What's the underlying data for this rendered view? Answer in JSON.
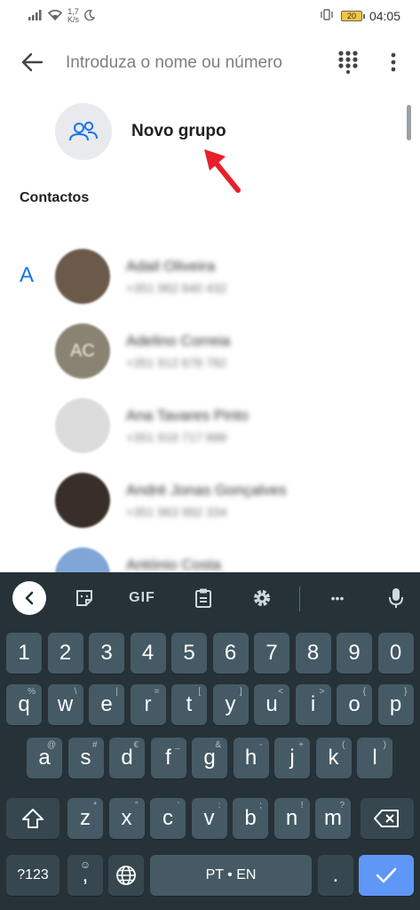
{
  "status_bar": {
    "speed_value": "1,7",
    "speed_unit": "K/s",
    "battery": "20",
    "time": "04:05"
  },
  "header": {
    "search_placeholder": "Introduza o nome ou número"
  },
  "new_group": {
    "label": "Novo grupo"
  },
  "section_title": "Contactos",
  "index_letter": "A",
  "contacts": [
    {
      "name": "Adail Oliveira",
      "phone": "+351 962 840 432",
      "avatar_color": "#6b5a4a"
    },
    {
      "name": "Adelino Correia",
      "phone": "+351 912 678 782",
      "avatar_color": "#8a8372",
      "initials": "AC"
    },
    {
      "name": "Ana Tavares Pinto",
      "phone": "+351 916 717 888",
      "avatar_color": "#dcdcdc"
    },
    {
      "name": "André Jonas Gonçalves",
      "phone": "+351 963 992 334",
      "avatar_color": "#3a2f28"
    },
    {
      "name": "António Costa",
      "phone": "",
      "avatar_color": "#7fa6d6"
    }
  ],
  "keyboard": {
    "toolbar": {
      "gif": "GIF",
      "more": "•••"
    },
    "row_numbers": [
      "1",
      "2",
      "3",
      "4",
      "5",
      "6",
      "7",
      "8",
      "9",
      "0"
    ],
    "row1": [
      {
        "k": "q",
        "h": "%"
      },
      {
        "k": "w",
        "h": "\\"
      },
      {
        "k": "e",
        "h": "|"
      },
      {
        "k": "r",
        "h": "="
      },
      {
        "k": "t",
        "h": "["
      },
      {
        "k": "y",
        "h": "]"
      },
      {
        "k": "u",
        "h": "<"
      },
      {
        "k": "i",
        "h": ">"
      },
      {
        "k": "o",
        "h": "{"
      },
      {
        "k": "p",
        "h": "}"
      }
    ],
    "row2": [
      {
        "k": "a",
        "h": "@"
      },
      {
        "k": "s",
        "h": "#"
      },
      {
        "k": "d",
        "h": "€"
      },
      {
        "k": "f",
        "h": "_"
      },
      {
        "k": "g",
        "h": "&"
      },
      {
        "k": "h",
        "h": "-"
      },
      {
        "k": "j",
        "h": "+"
      },
      {
        "k": "k",
        "h": "("
      },
      {
        "k": "l",
        "h": ")"
      }
    ],
    "row3": [
      {
        "k": "z",
        "h": "*"
      },
      {
        "k": "x",
        "h": "\""
      },
      {
        "k": "c",
        "h": "'"
      },
      {
        "k": "v",
        "h": ":"
      },
      {
        "k": "b",
        "h": ";"
      },
      {
        "k": "n",
        "h": "!"
      },
      {
        "k": "m",
        "h": "?"
      }
    ],
    "symbols_key": "?123",
    "comma": ",",
    "space_label": "PT • EN",
    "period": "."
  },
  "colors": {
    "accent": "#1a73e8",
    "arrow": "#e8202a",
    "keyboard_bg": "#263238",
    "key_bg": "#455a64",
    "enter_bg": "#5e97f6"
  }
}
